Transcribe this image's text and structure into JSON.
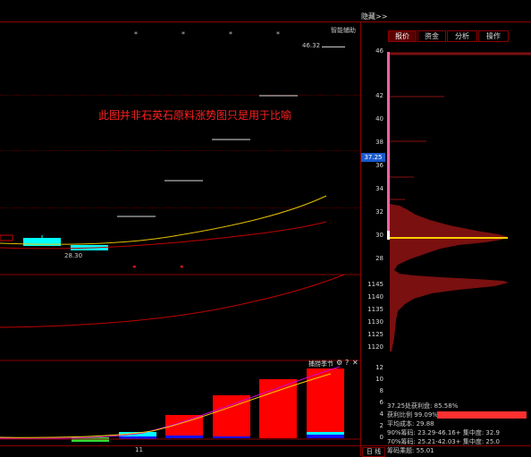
{
  "header": {
    "collapse_label": "隐藏>>"
  },
  "chart_tools": {
    "assist_label": "智能辅助"
  },
  "annotation": {
    "text": "此图并非石英石原料涨势图只是用于比喻"
  },
  "price_labels": {
    "high": "46.32",
    "low": "28.30"
  },
  "right_tabs": [
    "报价",
    "资金",
    "分析",
    "操作"
  ],
  "current_price": "37.25",
  "price_axis": [
    "46",
    "42",
    "40",
    "38",
    "36",
    "34",
    "32",
    "30",
    "28"
  ],
  "indicator_axis": [
    "1145",
    "1140",
    "1135",
    "1130",
    "1125",
    "1120"
  ],
  "bottom_panel": {
    "title": "捕捞季节",
    "question": "?",
    "close": "✕",
    "axis": [
      "12",
      "10",
      "8",
      "6",
      "4",
      "2",
      "0"
    ],
    "x_label": "11"
  },
  "bottom_tabs": {
    "day": "日",
    "line": "线"
  },
  "stats": {
    "profit_line": "37.25处获利盘: 85.58%",
    "profit_ratio_label": "获利比例",
    "profit_ratio_value": "99.09%",
    "avg_cost": "平均成本: 29.88",
    "chip90": "90%筹码: 23.29-46.16+ 集中度: 32.9",
    "chip70": "70%筹码: 25.21-42.03+ 集中度: 25.0",
    "chip_count": "筹码乘题: 55.01"
  },
  "colors": {
    "accent": "#ff0000",
    "cyan": "#00ffff",
    "grid": "#7a0000",
    "yellow": "#ffd000"
  }
}
